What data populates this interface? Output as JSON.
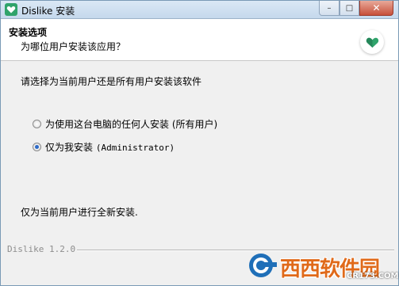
{
  "window": {
    "title": "Dislike 安装",
    "controls": {
      "minimize": "–",
      "maximize": "□",
      "close": "✕"
    }
  },
  "header": {
    "title": "安装选项",
    "subtitle": "为哪位用户安装该应用？"
  },
  "content": {
    "prompt": "请选择为当前用户还是所有用户安装该软件",
    "options": [
      {
        "label": "为使用这台电脑的任何人安装 (所有用户)",
        "checked": false
      },
      {
        "label_prefix": "仅为我安装 ",
        "label_user": "(Administrator)",
        "checked": true
      }
    ],
    "description": "仅为当前用户进行全新安装."
  },
  "footer": {
    "branding": "Dislike 1.2.0"
  },
  "watermark": {
    "text": "西西软件园",
    "url": "CR173.COM"
  },
  "colors": {
    "logo_green": "#2fa36b",
    "radio_selected": "#2d6ac8",
    "watermark_orange": "#e06a1a"
  }
}
